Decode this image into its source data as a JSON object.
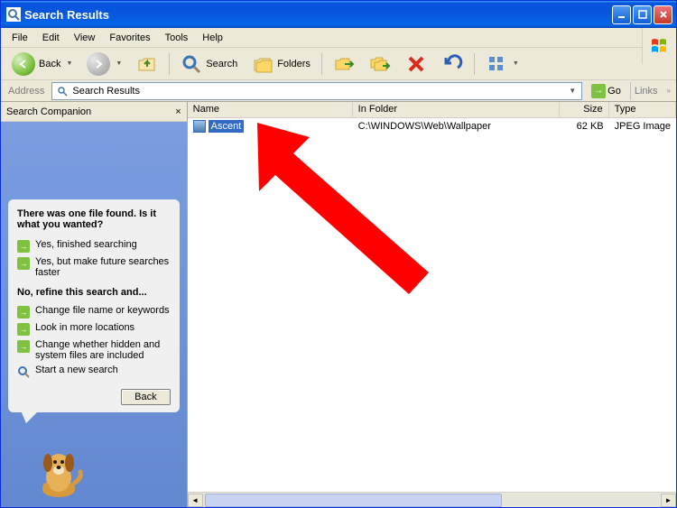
{
  "window": {
    "title": "Search Results"
  },
  "menu": [
    "File",
    "Edit",
    "View",
    "Favorites",
    "Tools",
    "Help"
  ],
  "toolbar": {
    "back": "Back",
    "search": "Search",
    "folders": "Folders"
  },
  "address": {
    "label": "Address",
    "value": "Search Results",
    "go": "Go",
    "links": "Links"
  },
  "sidebar": {
    "title": "Search Companion",
    "balloon": {
      "heading": "There was one file found.  Is it what you wanted?",
      "opt1": "Yes, finished searching",
      "opt2": "Yes, but make future searches faster",
      "refine_heading": "No, refine this search and...",
      "opt3": "Change file name or keywords",
      "opt4": "Look in more locations",
      "opt5": "Change whether hidden and system files are included",
      "opt6": "Start a new search",
      "back": "Back"
    }
  },
  "columns": {
    "name": "Name",
    "folder": "In Folder",
    "size": "Size",
    "type": "Type"
  },
  "rows": [
    {
      "name": "Ascent",
      "folder": "C:\\WINDOWS\\Web\\Wallpaper",
      "size": "62 KB",
      "type": "JPEG Image",
      "selected": true
    }
  ]
}
